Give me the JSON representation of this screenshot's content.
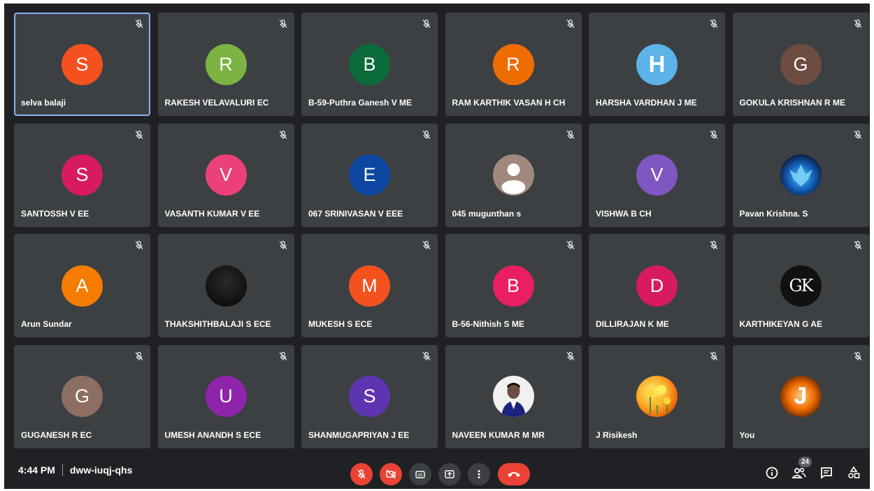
{
  "meeting": {
    "time": "4:44 PM",
    "code": "dww-iuqj-qhs",
    "participant_count": "24"
  },
  "colors": {
    "background": "#202124",
    "tile": "#3c4043",
    "active_border": "#8ab4f8",
    "danger": "#ea4335"
  },
  "participants": [
    {
      "name": "selva balaji",
      "initial": "S",
      "color": "#f4511e",
      "muted": true,
      "active": true
    },
    {
      "name": "RAKESH VELAVALURI EC",
      "initial": "R",
      "color": "#7cb342",
      "muted": true
    },
    {
      "name": "B-59-Puthra Ganesh V ME",
      "initial": "B",
      "color": "#0b6b3a",
      "muted": true
    },
    {
      "name": "RAM KARTHIK VASAN H CH",
      "initial": "R",
      "color": "#ef6c00",
      "muted": true
    },
    {
      "name": "HARSHA VARDHAN J ME",
      "initial": "H",
      "color": "#5bb3e8",
      "muted": true,
      "style": "logo"
    },
    {
      "name": "GOKULA KRISHNAN R ME",
      "initial": "G",
      "color": "#6d4c41",
      "muted": true
    },
    {
      "name": "SANTOSSH V EE",
      "initial": "S",
      "color": "#d81b60",
      "muted": true
    },
    {
      "name": "VASANTH KUMAR V EE",
      "initial": "V",
      "color": "#ec407a",
      "muted": true
    },
    {
      "name": "067 SRINIVASAN V EEE",
      "initial": "E",
      "color": "#0d47a1",
      "muted": true
    },
    {
      "name": "045 mugunthan s",
      "initial": "",
      "color": "#a1887f",
      "muted": true,
      "style": "person"
    },
    {
      "name": "VISHWA B CH",
      "initial": "V",
      "color": "#7e57c2",
      "muted": true
    },
    {
      "name": "Pavan Krishna. S",
      "initial": "",
      "color": "#0a0f2e",
      "muted": true,
      "style": "phoenix"
    },
    {
      "name": "Arun Sundar",
      "initial": "A",
      "color": "#f57c00",
      "muted": true
    },
    {
      "name": "THAKSHITHBALAJI S ECE",
      "initial": "",
      "color": "#111111",
      "muted": true,
      "style": "dark"
    },
    {
      "name": "MUKESH S ECE",
      "initial": "M",
      "color": "#f4511e",
      "muted": true
    },
    {
      "name": "B-56-Nithish S ME",
      "initial": "B",
      "color": "#e91e63",
      "muted": true
    },
    {
      "name": "DILLIRAJAN K ME",
      "initial": "D",
      "color": "#d81b60",
      "muted": true
    },
    {
      "name": "KARTHIKEYAN G AE",
      "initial": "GK",
      "color": "#111111",
      "muted": true,
      "style": "serif"
    },
    {
      "name": "GUGANESH R EC",
      "initial": "G",
      "color": "#8d6e63",
      "muted": true
    },
    {
      "name": "UMESH ANANDH S ECE",
      "initial": "U",
      "color": "#8e24aa",
      "muted": true
    },
    {
      "name": "SHANMUGAPRIYAN J EE",
      "initial": "S",
      "color": "#5e35b1",
      "muted": true
    },
    {
      "name": "NAVEEN KUMAR M MR",
      "initial": "",
      "color": "#e8e8e8",
      "muted": true,
      "style": "photo"
    },
    {
      "name": "J Risikesh",
      "initial": "",
      "color": "#f9a825",
      "muted": true,
      "style": "flowers"
    },
    {
      "name": "You",
      "initial": "J",
      "color": "#e65100",
      "muted": true,
      "style": "glow"
    }
  ],
  "controls": {
    "center": [
      "mic-off-icon",
      "camera-off-icon",
      "captions-icon",
      "present-icon",
      "more-options-icon",
      "leave-call-icon"
    ],
    "right": [
      "info-icon",
      "people-icon",
      "chat-icon",
      "activities-icon"
    ]
  }
}
